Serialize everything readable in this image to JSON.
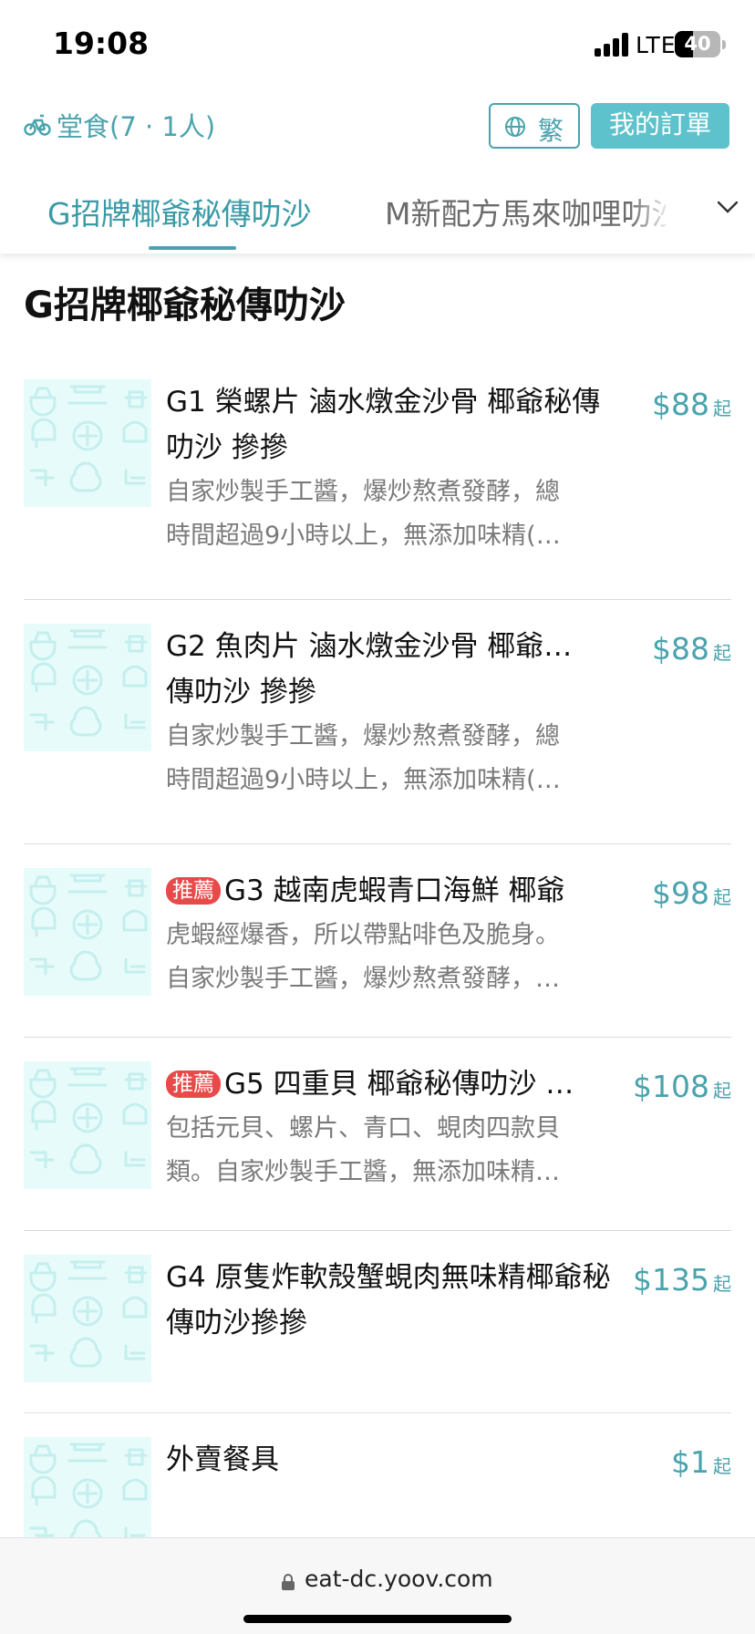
{
  "status_bar": {
    "time": "19:08",
    "network": "LTE",
    "battery_level": "40",
    "battery_fraction": 0.4
  },
  "header": {
    "dine_in_label": "堂食(7 · 1人)",
    "dine_in_icon": "bicycle-icon",
    "language_label": "繁",
    "language_icon": "globe-icon",
    "orders_label": "我的訂單"
  },
  "tabs": {
    "active_label": "G招牌椰爺秘傳叻沙",
    "next_label": "M新配方馬來咖哩叻沙",
    "expand_icon": "chevron-down-icon"
  },
  "section": {
    "title": "G招牌椰爺秘傳叻沙"
  },
  "items": [
    {
      "name": "G1 榮螺片 滷水燉金沙骨 椰爺秘傳叻沙 摻摻",
      "desc_lines": [
        "自家炒製手工醬，爆炒熬煮發酵，總",
        "時間超過9小時以上，無添加味精(…"
      ],
      "price": "$88",
      "price_suffix": "起",
      "badge": ""
    },
    {
      "name_line1": "G2 魚肉片 滷水燉金沙骨 椰爺…",
      "name_line2": "傳叻沙 摻摻",
      "desc_lines": [
        "自家炒製手工醬，爆炒熬煮發酵，總",
        "時間超過9小時以上，無添加味精(…"
      ],
      "price": "$88",
      "price_suffix": "起",
      "badge": ""
    },
    {
      "name": "G3 越南虎蝦青口海鮮 椰爺",
      "desc_lines": [
        "虎蝦經爆香，所以帶點啡色及脆身。",
        "自家炒製手工醬，爆炒熬煮發酵，…"
      ],
      "price": "$98",
      "price_suffix": "起",
      "badge": "推薦"
    },
    {
      "name": "G5 四重貝 椰爺秘傳叻沙 …",
      "desc_lines": [
        "包括元貝、螺片、青口、蜆肉四款貝",
        "類。自家炒製手工醬，無添加味精…"
      ],
      "price": "$108",
      "price_suffix": "起",
      "badge": "推薦"
    },
    {
      "name": "G4 原隻炸軟殼蟹蜆肉無味精椰爺秘傳叻沙摻摻",
      "price": "$135",
      "price_suffix": "起",
      "badge": ""
    },
    {
      "name": "外賣餐具",
      "price": "$1",
      "price_suffix": "起",
      "badge": ""
    }
  ],
  "browser": {
    "url": "eat-dc.yoov.com",
    "lock_icon": "lock-icon"
  },
  "colors": {
    "accent": "#4aa3ad",
    "button_fill": "#5ec2cc",
    "badge": "#e84949",
    "thumb_bg": "#e8fbfb"
  }
}
